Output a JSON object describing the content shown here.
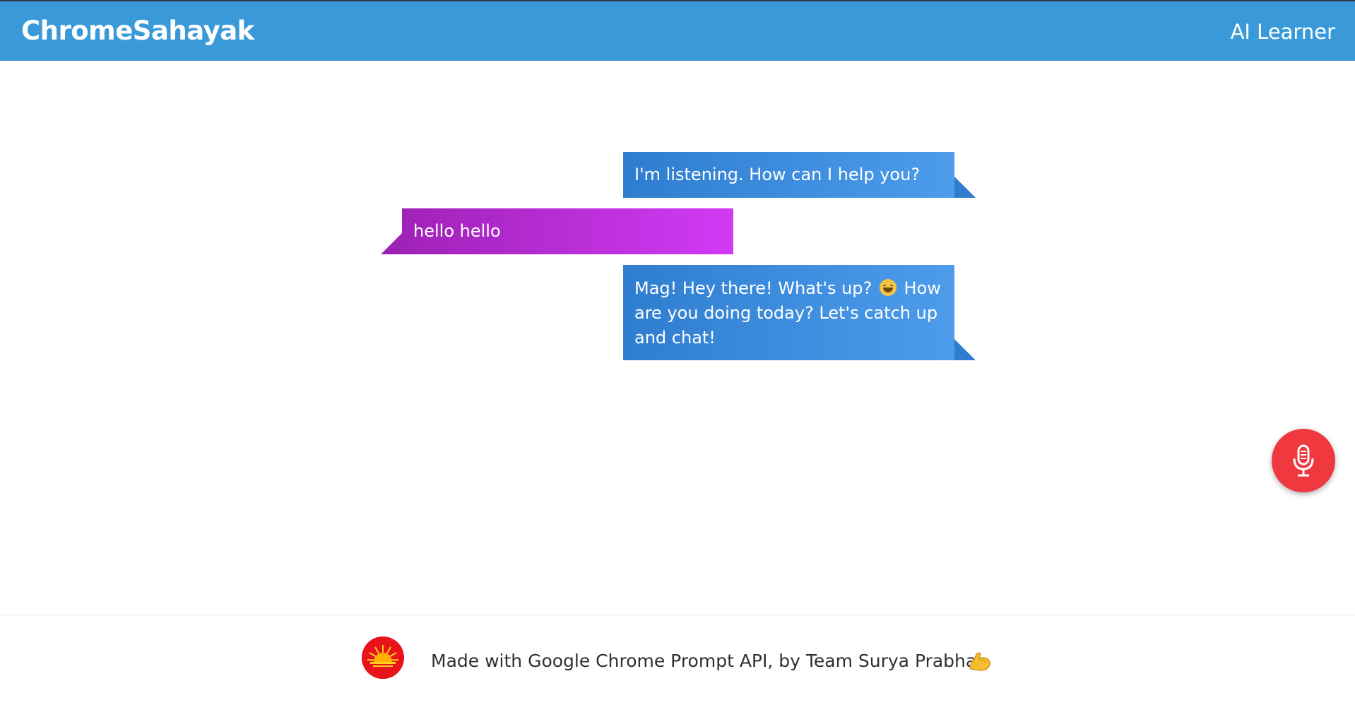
{
  "header": {
    "brand": "ChromeSahayak",
    "right_label": "AI Learner",
    "background_color": "#3a9ad9"
  },
  "chat": {
    "messages": [
      {
        "role": "assistant",
        "text": "I'm listening. How can I help you?"
      },
      {
        "role": "user",
        "text": "hello hello"
      },
      {
        "role": "assistant",
        "text_before_emoji": "Mag! Hey there! What's up?",
        "emoji": "grinning-face-with-smiling-eyes",
        "text_after_emoji": " How are you doing today? Let's catch up and chat!"
      }
    ],
    "assistant_bubble_color": "#3a8ee0",
    "user_bubble_color": "#c02cdf"
  },
  "mic_button": {
    "icon": "microphone-icon",
    "color": "#f0393f"
  },
  "footer": {
    "logo_icon": "sun-logo-icon",
    "text": "Made with Google Chrome Prompt API, by Team Surya Prabha",
    "trailing_icon": "flexed-biceps-icon"
  }
}
